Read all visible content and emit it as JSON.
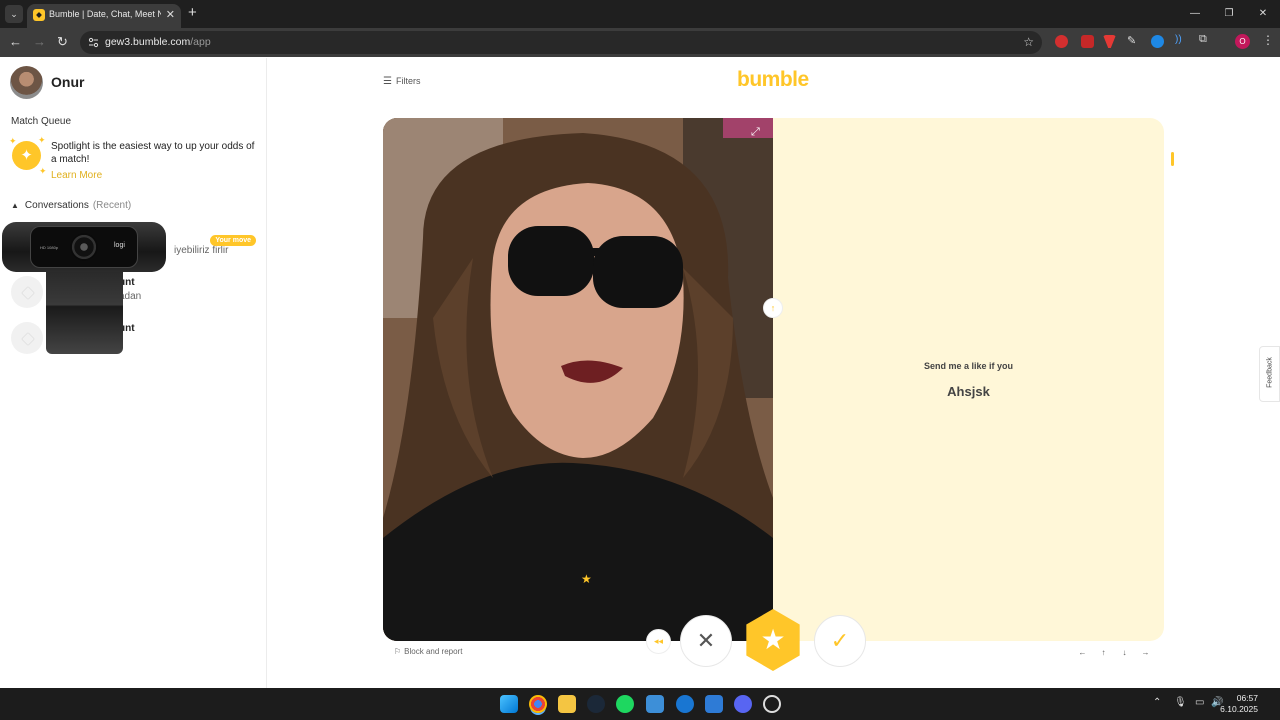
{
  "browser": {
    "tab_title": "Bumble | Date, Chat, Meet New",
    "url_host": "gew3.bumble.com",
    "url_path": "/app",
    "profile_initial": "O"
  },
  "sidebar": {
    "user_name": "Onur",
    "match_queue_title": "Match Queue",
    "spotlight_text": "Spotlight is the easiest way to up your odds of a match!",
    "learn_more": "Learn More",
    "conversations_title": "Conversations",
    "conversations_filter": "(Recent)",
    "conversations": [
      {
        "name": "",
        "message": "iyebiliriz firlir",
        "badge": "Your move"
      },
      {
        "name": "unt",
        "message": "adan",
        "badge": ""
      },
      {
        "name": "unt",
        "message": "",
        "badge": ""
      }
    ]
  },
  "webcam": {
    "brand": "logi",
    "label": "HD 1080p"
  },
  "main": {
    "filters_label": "Filters",
    "logo_text": "bumble",
    "profile_prompt": "Send me a like if you",
    "profile_answer": "Ahsjsk",
    "block_report": "Block and report",
    "feedback": "Feedback",
    "keyboard_hints": [
      "←",
      "↑",
      "↓",
      "→"
    ]
  },
  "taskbar": {
    "time": "06:57",
    "date": "6.10.2025"
  },
  "colors": {
    "brand_yellow": "#ffc629",
    "card_bg": "#fff7d8"
  }
}
